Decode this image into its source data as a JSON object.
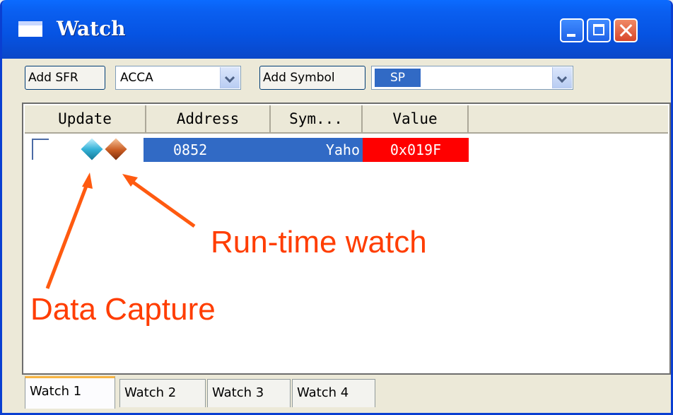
{
  "window": {
    "title": "Watch",
    "icon": "window-icon",
    "controls": [
      "minimize-icon",
      "maximize-icon",
      "close-icon"
    ]
  },
  "toolbar": {
    "add_sfr_label": "Add SFR",
    "sfr_select_value": "ACCA",
    "add_symbol_label": "Add Symbol",
    "symbol_select_value": "SP"
  },
  "table": {
    "columns": [
      "Update",
      "Address",
      "Sym...",
      "Value"
    ],
    "rows": [
      {
        "address": "0852",
        "symbol": "Yaho",
        "value": "0x019F",
        "value_color": "#ff0000"
      }
    ]
  },
  "annotations": {
    "run_time": "Run-time watch",
    "data_capture": "Data Capture",
    "color": "#ff3d00"
  },
  "tabs": [
    "Watch 1",
    "Watch 2",
    "Watch 3",
    "Watch 4"
  ],
  "colors": {
    "titlebar": "#0653e2",
    "row_highlight": "#316ac5",
    "window_bg": "#ece9d8"
  }
}
